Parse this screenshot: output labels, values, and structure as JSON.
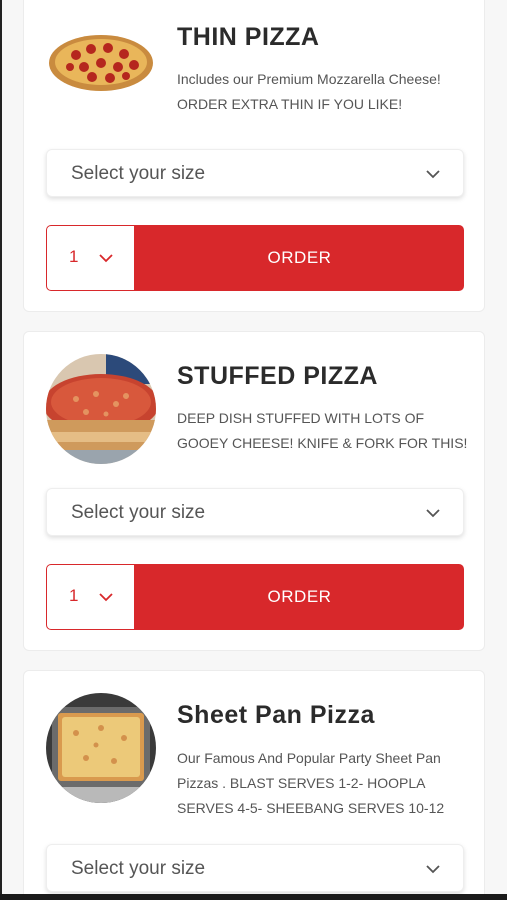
{
  "colors": {
    "accent": "#d8282b",
    "card_bg": "#ffffff",
    "page_bg": "#f7f7f7"
  },
  "products": [
    {
      "name": "THIN PIZZA",
      "description": [
        "Includes our Premium Mozzarella Cheese!",
        "ORDER EXTRA THIN IF YOU LIKE!"
      ],
      "size_placeholder": "Select your size",
      "quantity": "1",
      "order_label": "ORDER",
      "image": "pepperoni-pizza-image"
    },
    {
      "name": "STUFFED PIZZA",
      "description": [
        "DEEP DISH STUFFED WITH LOTS OF",
        "GOOEY CHEESE! KNIFE & FORK FOR THIS!"
      ],
      "size_placeholder": "Select your size",
      "quantity": "1",
      "order_label": "ORDER",
      "image": "stuffed-pizza-image"
    },
    {
      "name": "Sheet Pan Pizza",
      "description": [
        "Our Famous And Popular Party Sheet Pan",
        "Pizzas . BLAST SERVES 1-2- HOOPLA",
        "SERVES 4-5- SHEEBANG SERVES 10-12"
      ],
      "size_placeholder": "Select your size",
      "image": "sheet-pan-pizza-image"
    }
  ]
}
